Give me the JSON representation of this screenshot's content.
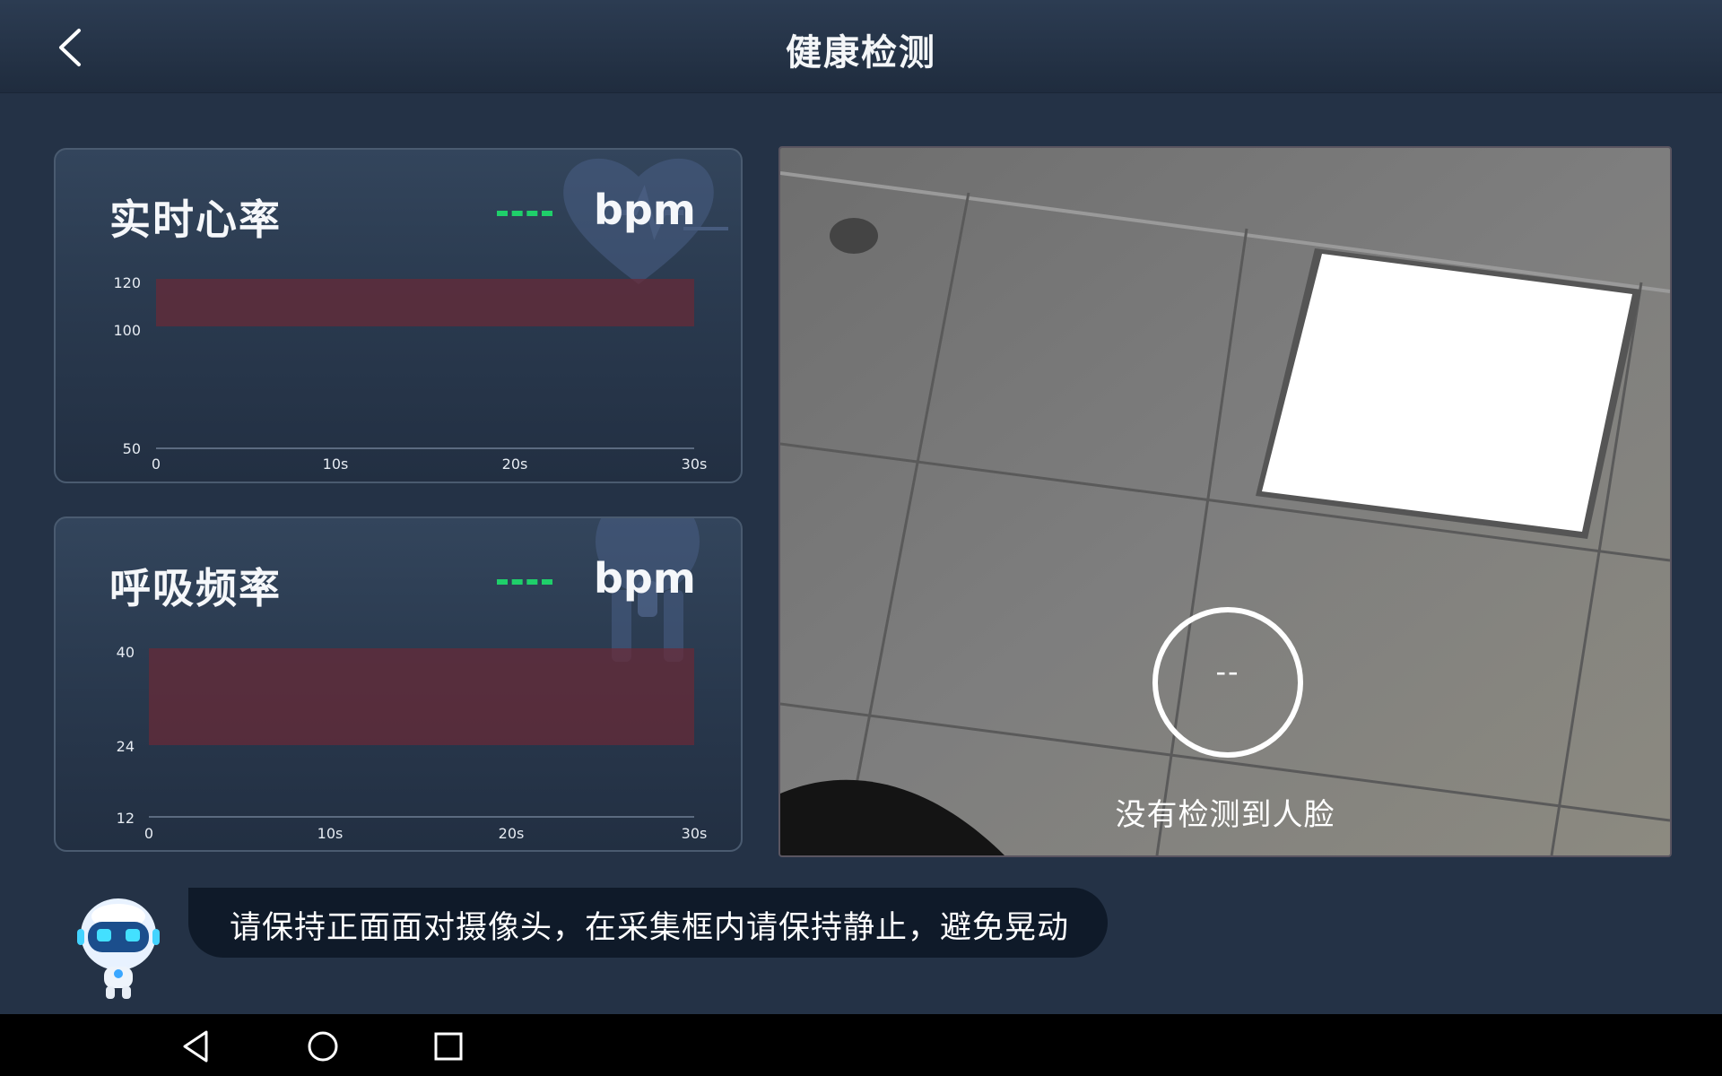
{
  "header": {
    "title": "健康检测",
    "back_icon": "chevron-left-icon"
  },
  "heart_rate": {
    "title": "实时心率",
    "value": "--",
    "unit": "bpm",
    "icon": "heart-icon",
    "value_color": "#1fcf6a",
    "normal_range": [
      100,
      120
    ],
    "y_ticks": [
      "120",
      "100",
      "50"
    ],
    "x_ticks": [
      "0",
      "10s",
      "20s",
      "30s"
    ]
  },
  "respiration": {
    "title": "呼吸频率",
    "value": "--",
    "unit": "bpm",
    "icon": "lungs-icon",
    "value_color": "#1fcf6a",
    "normal_range": [
      24,
      40
    ],
    "y_ticks": [
      "40",
      "24",
      "12"
    ],
    "x_ticks": [
      "0",
      "10s",
      "20s",
      "30s"
    ]
  },
  "camera": {
    "face_value": "--",
    "status": "没有检测到人脸"
  },
  "assistant": {
    "icon": "robot-icon",
    "hint": "请保持正面面对摄像头，在采集框内请保持静止，避免晃动"
  },
  "nav": {
    "back_icon": "triangle-back-icon",
    "home_icon": "circle-home-icon",
    "recents_icon": "square-recents-icon"
  },
  "colors": {
    "background": "#243246",
    "range_fill": "#6b2a36",
    "accent": "#1fcf6a"
  }
}
